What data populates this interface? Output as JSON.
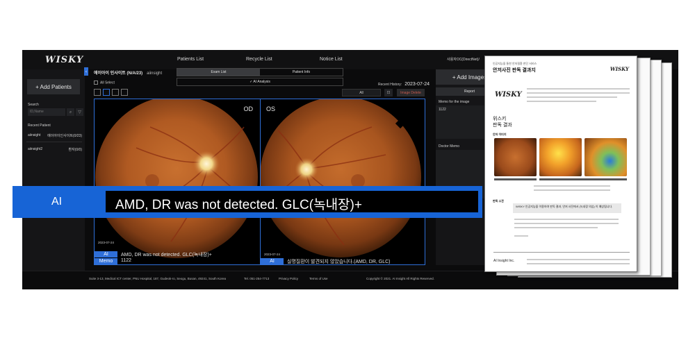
{
  "app": {
    "logo": "WISKY",
    "nav": [
      "Patients List",
      "Recycle List",
      "Notice List"
    ],
    "org": "사용자OC(DirectNet)/",
    "sidebar": {
      "add_patient": "+ Add Patients",
      "search_label": "Search",
      "search_placeholder": "ID,Name",
      "recent_label": "Recent Patient",
      "recent": [
        {
          "name": "aiinsight",
          "info": "에이아이인사이트(0/23)"
        },
        {
          "name": "aiinsight2",
          "info": "환자(0/0)"
        }
      ]
    },
    "center": {
      "patient_name": "에이아이 인사이트 (N/A/23)",
      "patient_id": "aiinsight",
      "tabs": [
        "Exam List",
        "Patient Info"
      ],
      "ai_analysis": "✓  AI Analysis",
      "all_select": "All Select",
      "recent_history_label": "Recent History:",
      "recent_history_date": "2023-07-24",
      "filter_value": "All",
      "image_delete": "Image Delete",
      "images": [
        {
          "eye": "OD",
          "date": "2023-07-24",
          "ai_tag": "AI",
          "ai_text": "AMD, DR was not detected. GLC(녹내장)+",
          "memo_tag": "Memo",
          "memo_text": "1122"
        },
        {
          "eye": "OS",
          "date": "2023-07-24",
          "ai_tag": "AI",
          "ai_text": "실명질환이 발견되지 않았습니다.(AMD, DR, GLC)"
        }
      ]
    },
    "right": {
      "add_images": "+ Add Images",
      "report": "Report",
      "memo_label": "Memo for the image",
      "memo_value": "1122",
      "doctor_memo_label": "Doctor Memo"
    },
    "footer": {
      "address": "Suite 3-13, Medical ICT center, PNU Hospital, 187, Gudeok-ro, Seogu, Busan, 49241, South Korea",
      "tel": "Tel. 051-254-7713",
      "privacy": "Privacy Policy",
      "terms": "Terms of Use",
      "copyright": "Copyright © 2021. AI Insight All Rights Reserved."
    }
  },
  "banner": {
    "label": "AI",
    "text": "AMD, DR was not detected. GLC(녹내장)+"
  },
  "report": {
    "subtitle": "인공지능을 통한 안저질환 판단 서비스",
    "title": "안저사진 판독 결과지",
    "logo": "WISKY",
    "section_title_1": "위스키",
    "section_title_2": "판독 결과",
    "images_head": "안저 이미지",
    "result_head": "판독 소견",
    "result_text": "WISKY 인공지능을 이용하여 판독 결과, 안저 사진에서 (녹내장 의심) 이 예상됩니다.",
    "company": "AI Insight Inc."
  },
  "colors": {
    "accent": "#1764d6",
    "app_bg": "#0b0b0c",
    "danger_text": "#c95b4f"
  }
}
